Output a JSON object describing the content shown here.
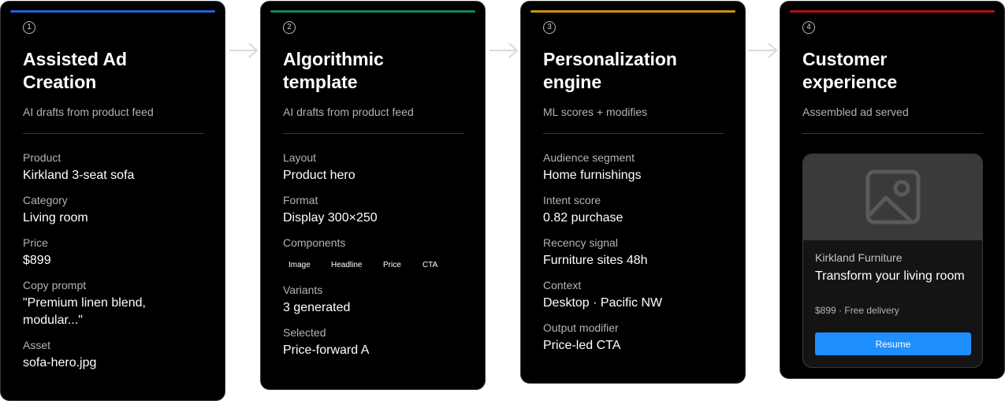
{
  "colors": {
    "accent_1": "#1f62d6",
    "accent_2": "#14855a",
    "accent_3": "#c8940f",
    "accent_4": "#b01214",
    "button": "#1f8fff"
  },
  "icons": {
    "arrow": "arrow-right-icon",
    "ad_image": "image-placeholder-icon"
  },
  "cards": [
    {
      "step": "1",
      "title": "Assisted Ad Creation",
      "subtitle": "AI drafts from product feed",
      "fields": [
        {
          "label": "Product",
          "value": "Kirkland 3-seat sofa"
        },
        {
          "label": "Category",
          "value": "Living room"
        },
        {
          "label": "Price",
          "value": "$899"
        },
        {
          "label": "Copy prompt",
          "value": "\"Premium linen blend, modular...\""
        },
        {
          "label": "Asset",
          "value": "sofa-hero.jpg"
        }
      ]
    },
    {
      "step": "2",
      "title": "Algorithmic template",
      "subtitle": "AI drafts from product feed",
      "fields": [
        {
          "label": "Layout",
          "value": "Product hero"
        },
        {
          "label": "Format",
          "value": "Display 300×250"
        },
        {
          "label": "Components",
          "chips": [
            "Image",
            "Headline",
            "Price",
            "CTA"
          ]
        },
        {
          "label": "Variants",
          "value": "3 generated"
        },
        {
          "label": "Selected",
          "value": "Price-forward A"
        }
      ]
    },
    {
      "step": "3",
      "title": "Personalization engine",
      "subtitle": "ML scores + modifies",
      "fields": [
        {
          "label": "Audience segment",
          "value": "Home furnishings"
        },
        {
          "label": "Intent score",
          "value": "0.82 purchase"
        },
        {
          "label": "Recency signal",
          "value": "Furniture sites 48h"
        },
        {
          "label": "Context",
          "value": "Desktop · Pacific NW"
        },
        {
          "label": "Output modifier",
          "value": "Price-led CTA"
        }
      ]
    },
    {
      "step": "4",
      "title": "Customer experience",
      "subtitle": "Assembled ad served",
      "ad": {
        "brand": "Kirkland Furniture",
        "headline": "Transform your living room",
        "meta": "$899 · Free delivery",
        "button": "Resume"
      }
    }
  ]
}
